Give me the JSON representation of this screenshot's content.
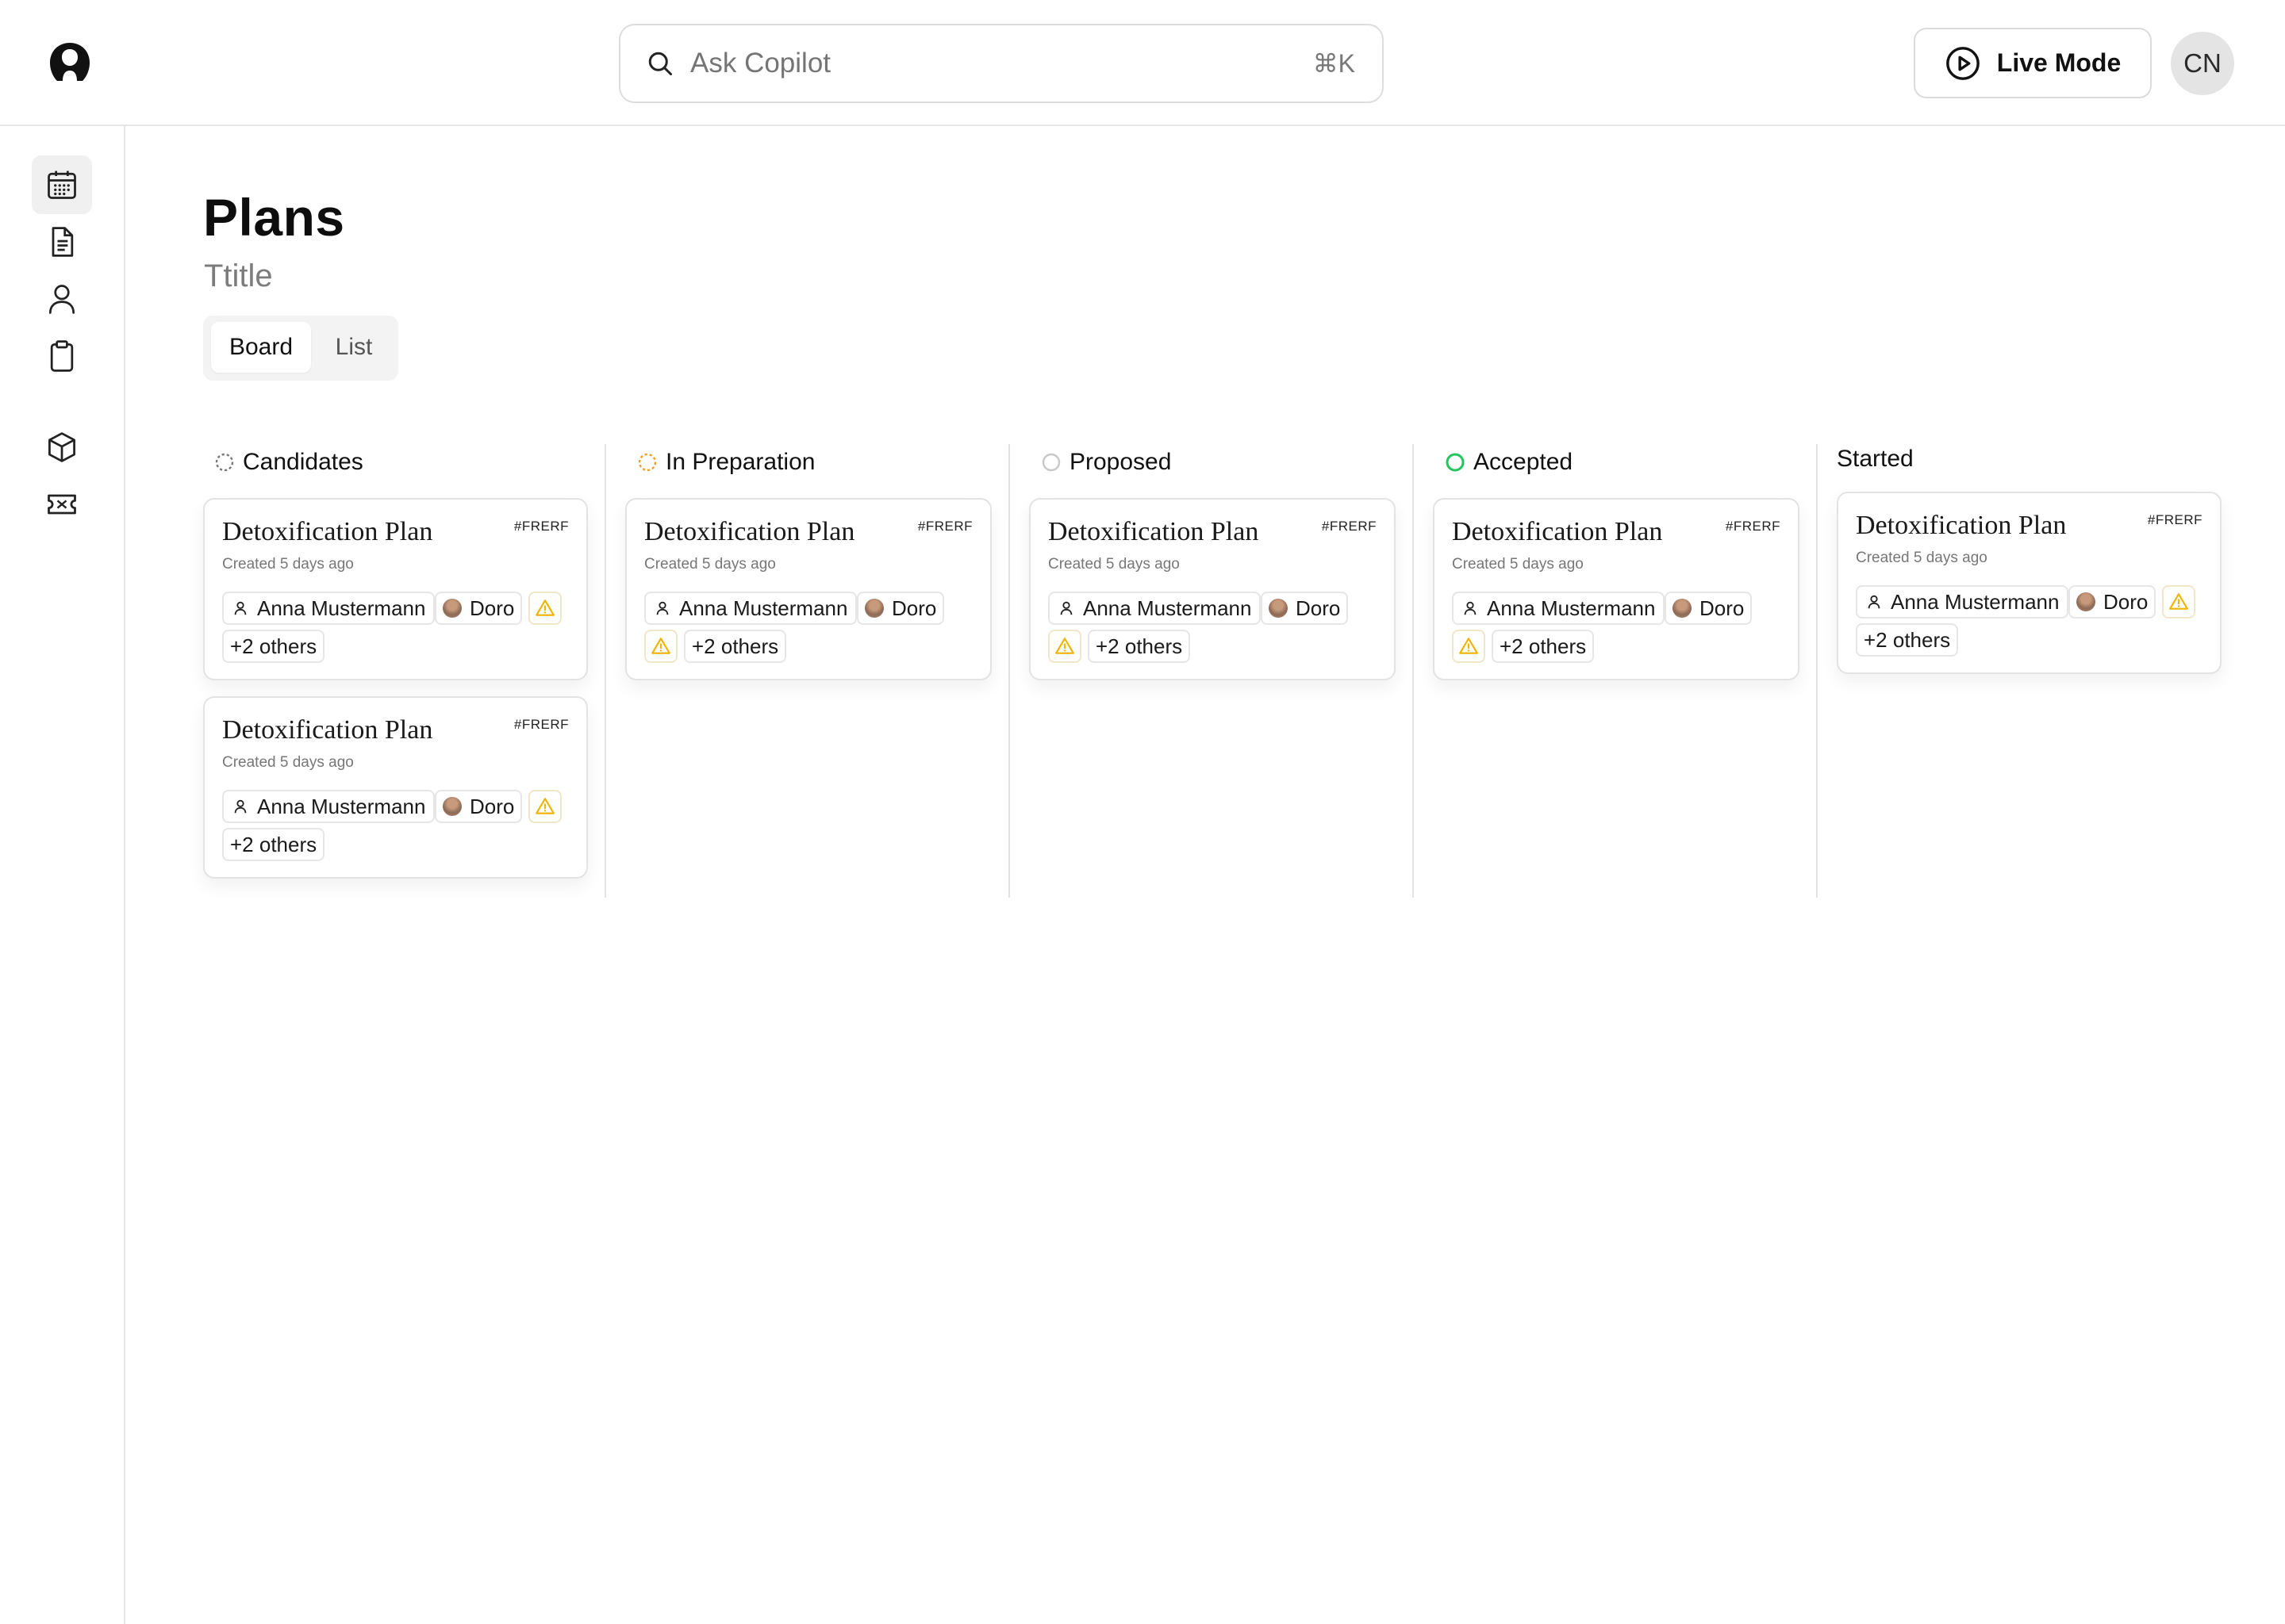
{
  "header": {
    "logo_icon": "user-circle-logo",
    "search": {
      "placeholder": "Ask Copilot",
      "shortcut": "⌘K",
      "icon": "search-icon"
    },
    "live_mode_label": "Live Mode",
    "avatar_initials": "CN"
  },
  "sidebar": {
    "items": [
      {
        "name": "calendar",
        "icon": "calendar-icon",
        "active": true
      },
      {
        "name": "documents",
        "icon": "document-icon",
        "active": false
      },
      {
        "name": "users",
        "icon": "user-icon",
        "active": false
      },
      {
        "name": "clipboard",
        "icon": "clipboard-icon",
        "active": false
      },
      {
        "name": "products",
        "icon": "cube-icon",
        "active": false
      },
      {
        "name": "tickets",
        "icon": "ticket-icon",
        "active": false
      }
    ]
  },
  "page": {
    "title": "Plans",
    "subtitle": "Ttitle",
    "view_tabs": [
      {
        "label": "Board",
        "selected": true
      },
      {
        "label": "List",
        "selected": false
      }
    ]
  },
  "board": {
    "columns": [
      {
        "title": "Candidates",
        "status_icon": "dashed-circle-gray",
        "cards": [
          {
            "title": "Detoxification Plan",
            "created": "Created 5 days ago",
            "tag": "#FRERF",
            "person": "Anna Mustermann",
            "assignee": "Doro",
            "others": "+2 others"
          },
          {
            "title": "Detoxification Plan",
            "created": "Created 5 days ago",
            "tag": "#FRERF",
            "person": "Anna Mustermann",
            "assignee": "Doro",
            "others": "+2 others"
          }
        ]
      },
      {
        "title": "In Preparation",
        "status_icon": "dashed-circle-orange",
        "cards": [
          {
            "title": "Detoxification Plan",
            "created": "Created 5 days ago",
            "tag": "#FRERF",
            "person": "Anna Mustermann",
            "assignee": "Doro",
            "others": "+2 others"
          }
        ]
      },
      {
        "title": "Proposed",
        "status_icon": "circle-gray",
        "cards": [
          {
            "title": "Detoxification Plan",
            "created": "Created 5 days ago",
            "tag": "#FRERF",
            "person": "Anna Mustermann",
            "assignee": "Doro",
            "others": "+2 others"
          }
        ]
      },
      {
        "title": "Accepted",
        "status_icon": "circle-green",
        "cards": [
          {
            "title": "Detoxification Plan",
            "created": "Created 5 days ago",
            "tag": "#FRERF",
            "person": "Anna Mustermann",
            "assignee": "Doro",
            "others": "+2 others"
          }
        ]
      },
      {
        "title": "Started",
        "status_icon": "",
        "cards": [
          {
            "title": "Detoxification Plan",
            "created": "Created 5 days ago",
            "tag": "#FRERF",
            "person": "Anna Mustermann",
            "assignee": "Doro",
            "others": "+2 others"
          }
        ]
      }
    ]
  },
  "colors": {
    "warning": "#f0b400",
    "in_preparation": "#f0a020",
    "accepted": "#22c55e",
    "neutral_status": "#c8c8c8"
  }
}
